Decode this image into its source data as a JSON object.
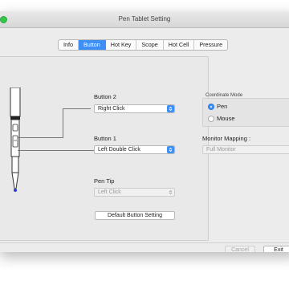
{
  "window": {
    "title": "Pen Tablet Setting"
  },
  "tabs": [
    "Info",
    "Button",
    "Hot Key",
    "Scope",
    "Hot Cell",
    "Pressure"
  ],
  "selected_tab": "Button",
  "button2": {
    "label": "Button 2",
    "value": "Right Click"
  },
  "button1": {
    "label": "Button 1",
    "value": "Left Double Click"
  },
  "pen_tip": {
    "label": "Pen Tip",
    "value": "Left Click"
  },
  "default_button": "Default Button Setting",
  "coordinate_mode": {
    "label": "Coordinate Mode",
    "options": [
      "Pen",
      "Mouse"
    ],
    "selected": "Pen"
  },
  "monitor_mapping": {
    "label": "Monitor Mapping :",
    "value": "Full Monitor"
  },
  "footer": {
    "cancel": "Cancel",
    "exit": "Exit"
  },
  "colors": {
    "accent": "#3d8ef5",
    "window_bg": "#ececec",
    "close_button": "#34c84a"
  }
}
